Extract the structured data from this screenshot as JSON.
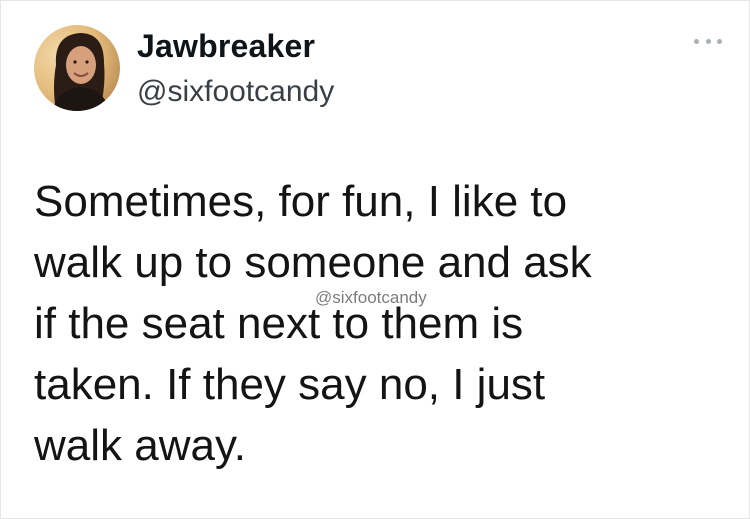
{
  "tweet": {
    "display_name": "Jawbreaker",
    "handle": "@sixfootcandy",
    "more_icon": "ellipsis-icon",
    "avatar_icon": "profile-photo",
    "text_lines": [
      "Sometimes, for fun, I like to",
      "walk up to someone and ask",
      "if the seat next to them is",
      "taken. If they say no, I just",
      "walk away."
    ]
  },
  "watermark": "@sixfootcandy",
  "colors": {
    "background": "#ffffff",
    "text": "#141414",
    "handle": "#3a3f44",
    "more_dots": "#a8b0b7"
  }
}
